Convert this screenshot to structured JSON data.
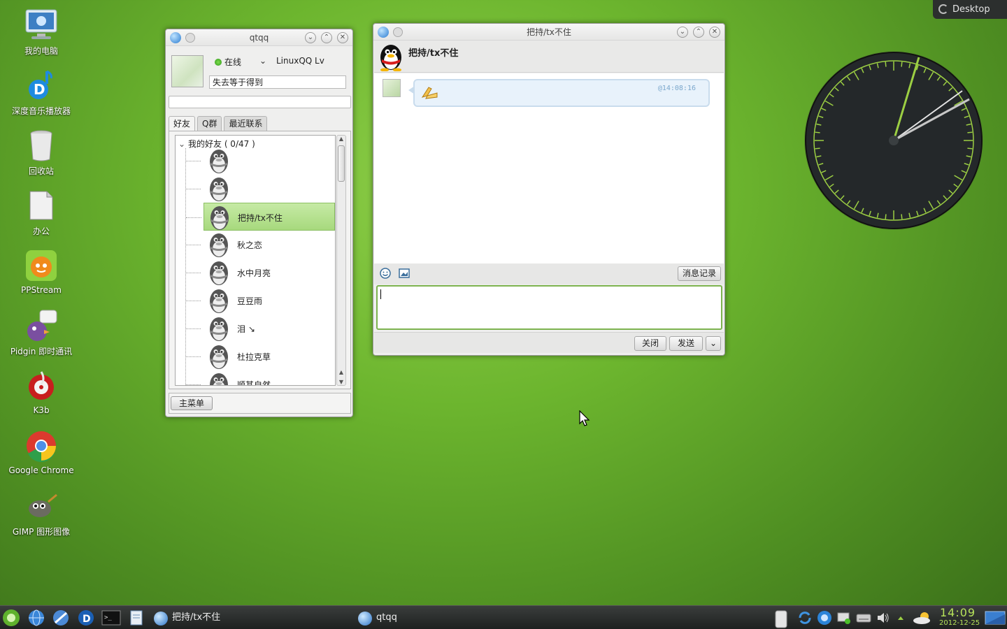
{
  "desktop": {
    "button_label": "Desktop",
    "icons": [
      {
        "label": "我的电脑",
        "icon": "computer-icon"
      },
      {
        "label": "深度音乐播放器",
        "icon": "music-player-icon"
      },
      {
        "label": "回收站",
        "icon": "trash-icon"
      },
      {
        "label": "办公",
        "icon": "document-icon"
      },
      {
        "label": "PPStream",
        "icon": "ppstream-icon"
      },
      {
        "label": "Pidgin 即时通讯",
        "icon": "pidgin-icon"
      },
      {
        "label": "K3b",
        "icon": "k3b-icon"
      },
      {
        "label": "Google Chrome",
        "icon": "chrome-icon"
      },
      {
        "label": "GIMP 图形图像",
        "icon": "gimp-icon"
      }
    ]
  },
  "qq_main": {
    "title": "qtqq",
    "status": "在线",
    "level": "LinuxQQ  Lv",
    "signature": "失去等于得到",
    "tabs": [
      "好友",
      "Q群",
      "最近联系"
    ],
    "group_label": "我的好友 ( 0/47 )",
    "friends": [
      "",
      "",
      "把持/tx不住",
      "秋之恋",
      "水中月亮",
      "豆豆雨",
      "    泪  ↘",
      "杜拉克草",
      "顺其自然"
    ],
    "selected_index": 2,
    "main_menu_label": "主菜单"
  },
  "chat": {
    "title": "把持/tx不住",
    "contact_name": "把持/tx不住",
    "message_time": "@14:08:16",
    "history_label": "消息记录",
    "close_label": "关闭",
    "send_label": "发送"
  },
  "taskbar": {
    "tasks": [
      {
        "label": "把持/tx不住"
      },
      {
        "label": "qtqq"
      }
    ],
    "time": "14:09",
    "date": "2012-12-25"
  },
  "colors": {
    "selection_green": "#a7d97d",
    "input_border_green": "#7db34f",
    "clock_face": "#24282a",
    "clock_accent": "#b6e35a"
  }
}
